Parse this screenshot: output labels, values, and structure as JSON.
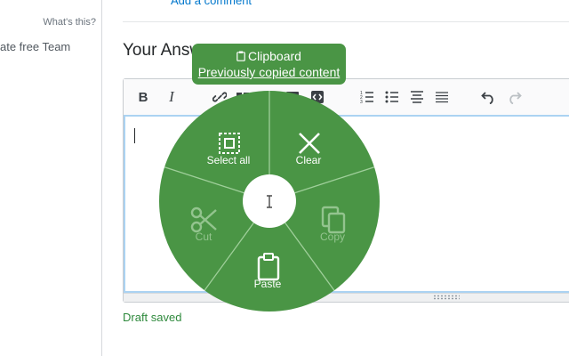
{
  "left_rail": {
    "whats_this": "What's this?",
    "team_text": "ate free Team"
  },
  "comments": {
    "add_comment": "Add a comment"
  },
  "answer": {
    "title": "Your Answ"
  },
  "editor": {
    "toolbar_icons": [
      "bold-icon",
      "italic-icon",
      "link-icon",
      "blockquote-icon",
      "code-icon",
      "image-icon",
      "snippet-icon",
      "ordered-list-icon",
      "bullet-list-icon",
      "heading-icon",
      "horizontal-rule-icon",
      "undo-icon",
      "redo-icon"
    ],
    "bold_label": "B",
    "italic_label": "I"
  },
  "status": {
    "draft_saved": "Draft saved"
  },
  "clipboard": {
    "title": "Clipboard",
    "link": "Previously copied content"
  },
  "pie_menu": {
    "items": [
      {
        "label": "Select all",
        "enabled": true
      },
      {
        "label": "Clear",
        "enabled": true
      },
      {
        "label": "Copy",
        "enabled": false
      },
      {
        "label": "Paste",
        "enabled": true
      },
      {
        "label": "Cut",
        "enabled": false
      }
    ]
  },
  "colors": {
    "menu_green": "#4a9545",
    "enabled_text": "#ffffff",
    "disabled_text": "#93c48e",
    "link_blue": "#0077cc",
    "draft_green": "#2f8a3d"
  }
}
